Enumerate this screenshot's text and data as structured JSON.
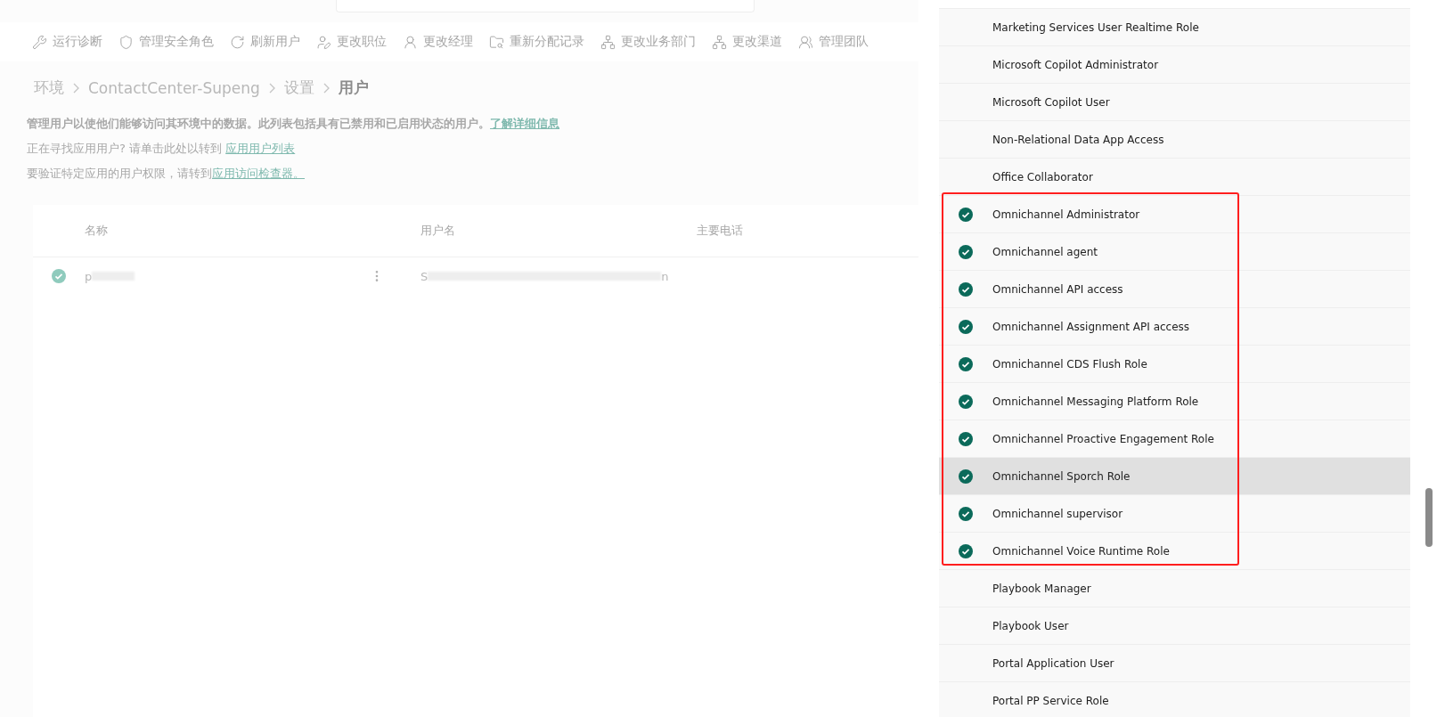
{
  "toolbar": [
    {
      "kind": "wrench",
      "label": "运行诊断"
    },
    {
      "kind": "shield",
      "label": "管理安全角色"
    },
    {
      "kind": "refresh",
      "label": "刷新用户"
    },
    {
      "kind": "user-edit",
      "label": "更改职位"
    },
    {
      "kind": "user",
      "label": "更改经理"
    },
    {
      "kind": "folder",
      "label": "重新分配记录"
    },
    {
      "kind": "hierarchy",
      "label": "更改业务部门"
    },
    {
      "kind": "hierarchy",
      "label": "更改渠道"
    },
    {
      "kind": "team",
      "label": "管理团队"
    }
  ],
  "breadcrumb": [
    {
      "label": "环境",
      "current": false
    },
    {
      "label": "ContactCenter-Supeng",
      "current": false
    },
    {
      "label": "设置",
      "current": false
    },
    {
      "label": "用户",
      "current": true
    }
  ],
  "description": {
    "text": "**管理用户以使他们能够访问其环境中的数据。此列表包括具有已禁用和已启用状态的用户。**",
    "link": "了解详细信息"
  },
  "hints": [
    {
      "text": "正在寻找应用用户? 请单击此处以转到 ",
      "link": "应用用户列表"
    },
    {
      "text": "要验证特定应用的用户权限，请转到",
      "link": "应用访问检查器。"
    }
  ],
  "table": {
    "columns": [
      "名称",
      "用户名",
      "主要电话"
    ],
    "rows": [
      {
        "checked": true,
        "name": "p",
        "username_start": "S",
        "username_end": "n"
      }
    ]
  },
  "role_groups": [
    {
      "kind": "plain",
      "roles": [
        {
          "name": "Marketing Services User Realtime Role",
          "checked": false,
          "selected": false
        },
        {
          "name": "Microsoft Copilot Administrator",
          "checked": false,
          "selected": false
        },
        {
          "name": "Microsoft Copilot User",
          "checked": false,
          "selected": false
        },
        {
          "name": "Non-Relational Data App Access",
          "checked": false,
          "selected": false
        },
        {
          "name": "Office Collaborator",
          "checked": false,
          "selected": false
        }
      ]
    },
    {
      "kind": "outlined",
      "roles": [
        {
          "name": "Omnichannel Administrator",
          "checked": true,
          "selected": false
        },
        {
          "name": "Omnichannel agent",
          "checked": true,
          "selected": false
        },
        {
          "name": "Omnichannel API access",
          "checked": true,
          "selected": false
        },
        {
          "name": "Omnichannel Assignment API access",
          "checked": true,
          "selected": false
        },
        {
          "name": "Omnichannel CDS Flush Role",
          "checked": true,
          "selected": false
        },
        {
          "name": "Omnichannel Messaging Platform Role",
          "checked": true,
          "selected": false
        },
        {
          "name": "Omnichannel Proactive Engagement Role",
          "checked": true,
          "selected": false
        },
        {
          "name": "Omnichannel Sporch Role",
          "checked": true,
          "selected": true
        },
        {
          "name": "Omnichannel supervisor",
          "checked": true,
          "selected": false
        },
        {
          "name": "Omnichannel Voice Runtime Role",
          "checked": true,
          "selected": false
        }
      ]
    },
    {
      "kind": "plain",
      "roles": [
        {
          "name": "Playbook Manager",
          "checked": false,
          "selected": false
        },
        {
          "name": "Playbook User",
          "checked": false,
          "selected": false
        },
        {
          "name": "Portal Application User",
          "checked": false,
          "selected": false
        },
        {
          "name": "Portal PP Service Role",
          "checked": false,
          "selected": false
        }
      ]
    }
  ]
}
